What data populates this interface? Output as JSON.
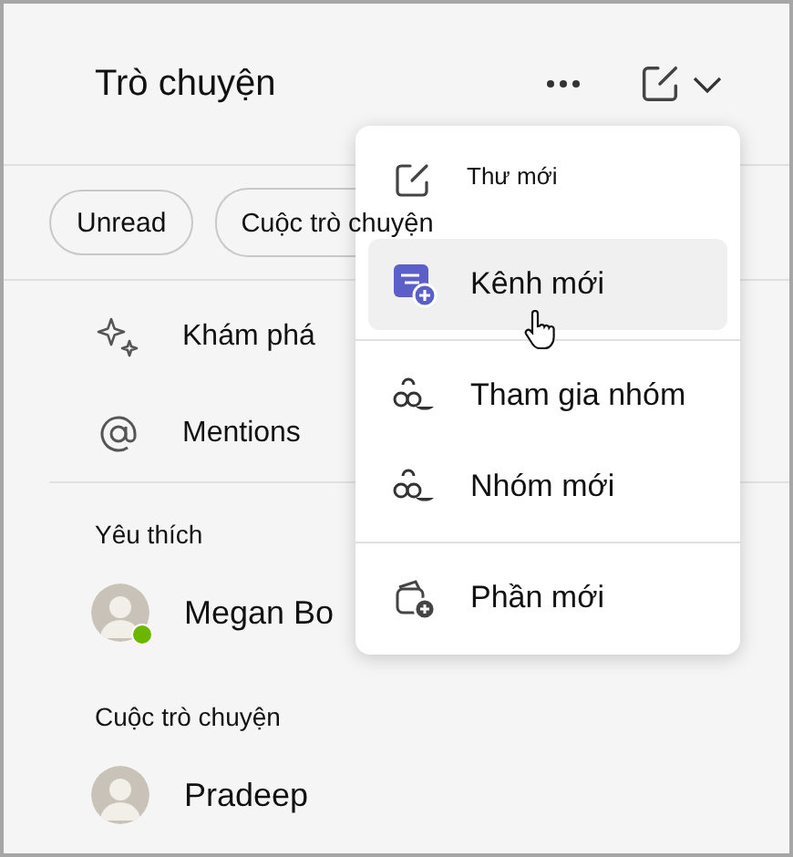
{
  "header": {
    "title": "Trò chuyện"
  },
  "filters": [
    {
      "label": "Unread",
      "selected": false
    },
    {
      "label": "Cuộc trò chuyện",
      "selected": false
    }
  ],
  "nav_items": [
    {
      "label": "Khám phá",
      "kind": "discover"
    },
    {
      "label": "Mentions",
      "kind": "mention"
    }
  ],
  "sections": [
    {
      "title": "Yêu thích",
      "chats": [
        {
          "name": "Megan Bo",
          "available": true
        }
      ]
    },
    {
      "title": "Cuộc trò chuyện",
      "chats": [
        {
          "name": "Pradeep",
          "available": false
        }
      ]
    }
  ],
  "menu": {
    "groups": [
      [
        {
          "label": "Thư mới",
          "kind": "compose",
          "selected": false
        },
        {
          "label": "Kênh mới",
          "kind": "channel",
          "selected": true
        }
      ],
      [
        {
          "label": "Tham gia nhóm",
          "kind": "group",
          "selected": false
        },
        {
          "label": "Nhóm mới",
          "kind": "group",
          "selected": false
        }
      ],
      [
        {
          "label": "Phần mới",
          "kind": "section",
          "selected": false
        }
      ]
    ]
  }
}
